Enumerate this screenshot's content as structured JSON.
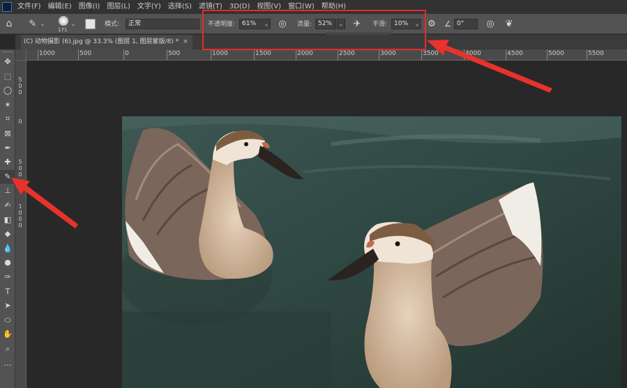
{
  "menu": [
    "文件(F)",
    "编辑(E)",
    "图像(I)",
    "图层(L)",
    "文字(Y)",
    "选择(S)",
    "滤镜(T)",
    "3D(D)",
    "视图(V)",
    "窗口(W)",
    "帮助(H)"
  ],
  "options": {
    "brush_size": "171",
    "mode_label": "模式:",
    "mode_value": "正常",
    "opacity_label": "不透明度:",
    "opacity_value": "61%",
    "flow_label": "流量:",
    "flow_value": "52%",
    "smoothing_label": "平滑:",
    "smoothing_value": "10%",
    "angle_value": "0°",
    "smoothing_slider_level": 0.55
  },
  "document_tab": {
    "title": "(C) 动物摄影 (6).jpg @ 33.3% (图层 1, 图层蒙版/8) *",
    "close": "×"
  },
  "ruler": {
    "horizontal_labels": [
      "1000",
      "500",
      "0",
      "500",
      "1000",
      "1500",
      "2000",
      "2500",
      "3000",
      "3500",
      "4000",
      "4500",
      "5000",
      "5500"
    ],
    "vertical_groups": [
      [
        "5",
        "0",
        "0"
      ],
      [
        "0"
      ],
      [
        "5",
        "0",
        "0"
      ],
      [
        "1",
        "0",
        "0",
        "0"
      ]
    ]
  },
  "tools": [
    "move-tool",
    "marquee-tool",
    "lasso-tool",
    "magic-wand-tool",
    "crop-tool",
    "frame-tool",
    "eyedropper-tool",
    "healing-brush-tool",
    "brush-tool",
    "clone-stamp-tool",
    "history-brush-tool",
    "eraser-tool",
    "paint-bucket-tool",
    "blur-tool",
    "dodge-tool",
    "pen-tool",
    "type-tool",
    "path-selection-tool",
    "shape-tool",
    "hand-tool",
    "zoom-tool",
    "more-tools"
  ],
  "tool_glyphs": [
    "✥",
    "⬚",
    "◯",
    "✶",
    "⌗",
    "⊠",
    "✒",
    "✚",
    "✎",
    "⊥",
    "✍",
    "◧",
    "◆",
    "💧",
    "●",
    "✑",
    "T",
    "➤",
    "⬭",
    "✋",
    "⌕",
    "…"
  ],
  "colors": {
    "highlight": "#e52b2b",
    "arrow": "#e8322c"
  }
}
